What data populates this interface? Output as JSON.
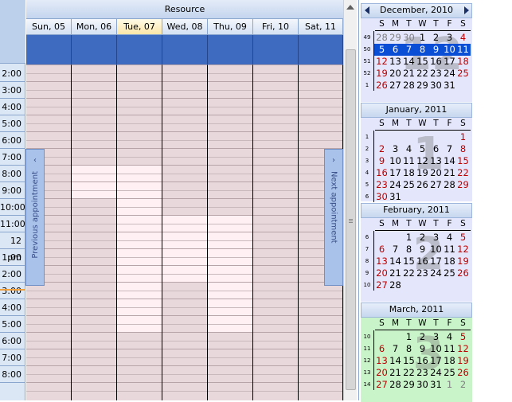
{
  "scheduler": {
    "resource_label": "Resource",
    "days": [
      {
        "label": "Sun, 05"
      },
      {
        "label": "Mon, 06"
      },
      {
        "label": "Tue, 07"
      },
      {
        "label": "Wed, 08"
      },
      {
        "label": "Thu, 09"
      },
      {
        "label": "Fri, 10"
      },
      {
        "label": "Sat, 11"
      }
    ],
    "today_index": 2,
    "times": [
      "2:00",
      "3:00",
      "4:00",
      "5:00",
      "6:00",
      "7:00",
      "8:00",
      "9:00",
      "10:00",
      "11:00",
      "12 pm",
      "1:00",
      "2:00",
      "3:00",
      "4:00",
      "5:00",
      "6:00",
      "7:00",
      "8:00"
    ],
    "prev_label": "Previous appointment",
    "next_label": "Next appointment",
    "colors": {
      "allday": "#3e6bc0",
      "cell": "#e8d8db",
      "work_cell": "#fff1f3",
      "nav_button": "#a9c2ea",
      "selected_week": "#0b4ed6",
      "weekend_text": "#c00000"
    },
    "icons": {
      "prev": "chevron-left-icon",
      "next": "chevron-right-icon"
    }
  },
  "calendar": {
    "nav": {
      "prev_icon": "triangle-left-icon",
      "next_icon": "triangle-right-icon"
    },
    "dow": [
      "S",
      "M",
      "T",
      "W",
      "T",
      "F",
      "S"
    ],
    "months": [
      {
        "title": "December, 2010",
        "big": "12",
        "weeks": [
          {
            "wk": "49",
            "days": [
              "28",
              "29",
              "30",
              "1",
              "2",
              "3",
              "4"
            ],
            "other": [
              0,
              1,
              2
            ]
          },
          {
            "wk": "50",
            "days": [
              "5",
              "6",
              "7",
              "8",
              "9",
              "10",
              "11"
            ],
            "selected": true
          },
          {
            "wk": "51",
            "days": [
              "12",
              "13",
              "14",
              "15",
              "16",
              "17",
              "18"
            ]
          },
          {
            "wk": "52",
            "days": [
              "19",
              "20",
              "21",
              "22",
              "23",
              "24",
              "25"
            ]
          },
          {
            "wk": "1",
            "days": [
              "26",
              "27",
              "28",
              "29",
              "30",
              "31",
              ""
            ]
          }
        ],
        "bg": "#e4e6fb"
      },
      {
        "title": "January, 2011",
        "big": "1",
        "weeks": [
          {
            "wk": "1",
            "days": [
              "",
              "",
              "",
              "",
              "",
              "",
              "1"
            ]
          },
          {
            "wk": "2",
            "days": [
              "2",
              "3",
              "4",
              "5",
              "6",
              "7",
              "8"
            ]
          },
          {
            "wk": "3",
            "days": [
              "9",
              "10",
              "11",
              "12",
              "13",
              "14",
              "15"
            ]
          },
          {
            "wk": "4",
            "days": [
              "16",
              "17",
              "18",
              "19",
              "20",
              "21",
              "22"
            ]
          },
          {
            "wk": "5",
            "days": [
              "23",
              "24",
              "25",
              "26",
              "27",
              "28",
              "29"
            ]
          },
          {
            "wk": "6",
            "days": [
              "30",
              "31",
              "",
              "",
              "",
              "",
              ""
            ]
          }
        ],
        "bg": "#e4e6fb"
      },
      {
        "title": "February, 2011",
        "big": "2",
        "weeks": [
          {
            "wk": "6",
            "days": [
              "",
              "",
              "1",
              "2",
              "3",
              "4",
              "5"
            ]
          },
          {
            "wk": "7",
            "days": [
              "6",
              "7",
              "8",
              "9",
              "10",
              "11",
              "12"
            ]
          },
          {
            "wk": "8",
            "days": [
              "13",
              "14",
              "15",
              "16",
              "17",
              "18",
              "19"
            ]
          },
          {
            "wk": "9",
            "days": [
              "20",
              "21",
              "22",
              "23",
              "24",
              "25",
              "26"
            ]
          },
          {
            "wk": "10",
            "days": [
              "27",
              "28",
              "",
              "",
              "",
              "",
              ""
            ]
          }
        ],
        "bg": "#e4e6fb"
      },
      {
        "title": "March, 2011",
        "big": "3",
        "weeks": [
          {
            "wk": "10",
            "days": [
              "",
              "",
              "1",
              "2",
              "3",
              "4",
              "5"
            ]
          },
          {
            "wk": "11",
            "days": [
              "6",
              "7",
              "8",
              "9",
              "10",
              "11",
              "12"
            ]
          },
          {
            "wk": "12",
            "days": [
              "13",
              "14",
              "15",
              "16",
              "17",
              "18",
              "19"
            ]
          },
          {
            "wk": "13",
            "days": [
              "20",
              "21",
              "22",
              "23",
              "24",
              "25",
              "26"
            ]
          },
          {
            "wk": "14",
            "days": [
              "27",
              "28",
              "29",
              "30",
              "31",
              "1",
              "2"
            ],
            "other": [
              5,
              6
            ]
          }
        ],
        "bg": "#c9f3c9"
      }
    ]
  }
}
